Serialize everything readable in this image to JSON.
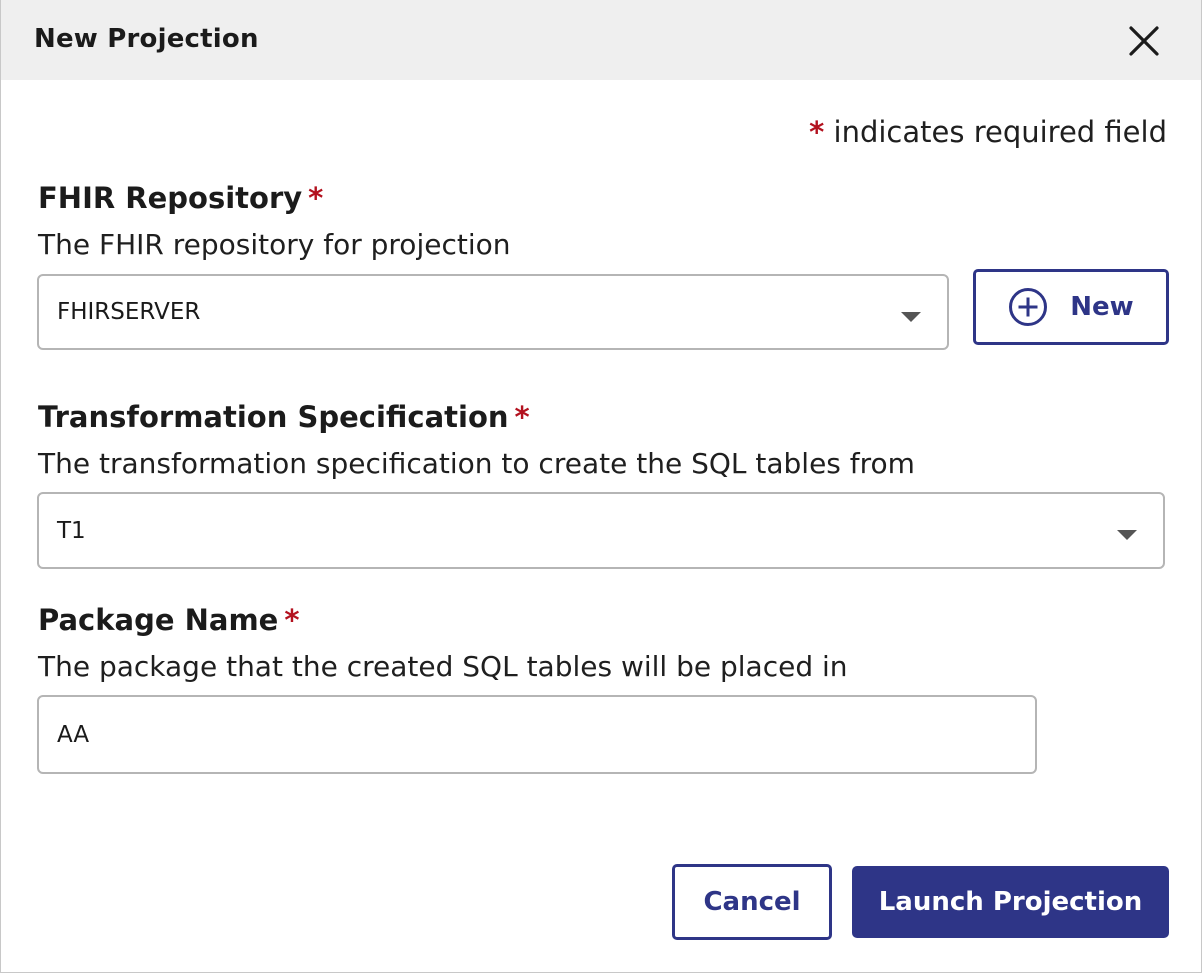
{
  "dialog": {
    "title": "New Projection",
    "required_note": "indicates required field",
    "required_marker": "*"
  },
  "fields": {
    "repository": {
      "label": "FHIR Repository",
      "help": "The FHIR repository for projection",
      "value": "FHIRSERVER",
      "new_button_label": "New"
    },
    "transformation": {
      "label": "Transformation Specification",
      "help": "The transformation specification to create the SQL tables from",
      "value": "T1"
    },
    "package": {
      "label": "Package Name",
      "help": "The package that the created SQL tables will be placed in",
      "value": "AA"
    }
  },
  "actions": {
    "cancel_label": "Cancel",
    "launch_label": "Launch Projection"
  },
  "icons": {
    "close": "close-icon",
    "add": "plus-circle-icon",
    "dropdown": "chevron-down-icon"
  },
  "colors": {
    "primary": "#2e3587",
    "required": "#b3121f",
    "header_bg": "#efefef"
  }
}
